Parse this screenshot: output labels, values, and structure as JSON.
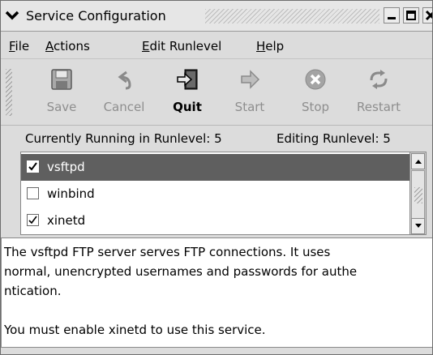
{
  "window": {
    "title": "Service Configuration"
  },
  "menubar": {
    "items": [
      {
        "label": "File",
        "mnemonic": "F",
        "rest": "ile"
      },
      {
        "label": "Actions",
        "mnemonic": "A",
        "rest": "ctions"
      },
      {
        "label": "Edit Runlevel",
        "mnemonic": "E",
        "rest": "dit Runlevel"
      },
      {
        "label": "Help",
        "mnemonic": "H",
        "rest": "elp"
      }
    ]
  },
  "toolbar": {
    "buttons": [
      {
        "label": "Save",
        "icon": "floppy-disk-icon",
        "enabled": false
      },
      {
        "label": "Cancel",
        "icon": "undo-arrow-icon",
        "enabled": false
      },
      {
        "label": "Quit",
        "icon": "exit-door-icon",
        "enabled": true
      },
      {
        "label": "Start",
        "icon": "right-arrow-icon",
        "enabled": false
      },
      {
        "label": "Stop",
        "icon": "stop-circle-icon",
        "enabled": false
      },
      {
        "label": "Restart",
        "icon": "refresh-arrows-icon",
        "enabled": false
      }
    ]
  },
  "status": {
    "running": "Currently Running in Runlevel: 5",
    "editing": "Editing Runlevel: 5"
  },
  "services": [
    {
      "name": "vsftpd",
      "checked": true,
      "selected": true
    },
    {
      "name": "winbind",
      "checked": false,
      "selected": false
    },
    {
      "name": "xinetd",
      "checked": true,
      "selected": false
    }
  ],
  "description": {
    "lines": [
      "The vsftpd FTP server serves FTP connections. It uses",
      "normal, unencrypted usernames and passwords for authe",
      "ntication.",
      "",
      "You must enable xinetd to use this service."
    ]
  },
  "colors": {
    "selection": "#5f5f5f",
    "window_bg": "#dcdcdc",
    "disabled_text": "#8e8e8e"
  }
}
